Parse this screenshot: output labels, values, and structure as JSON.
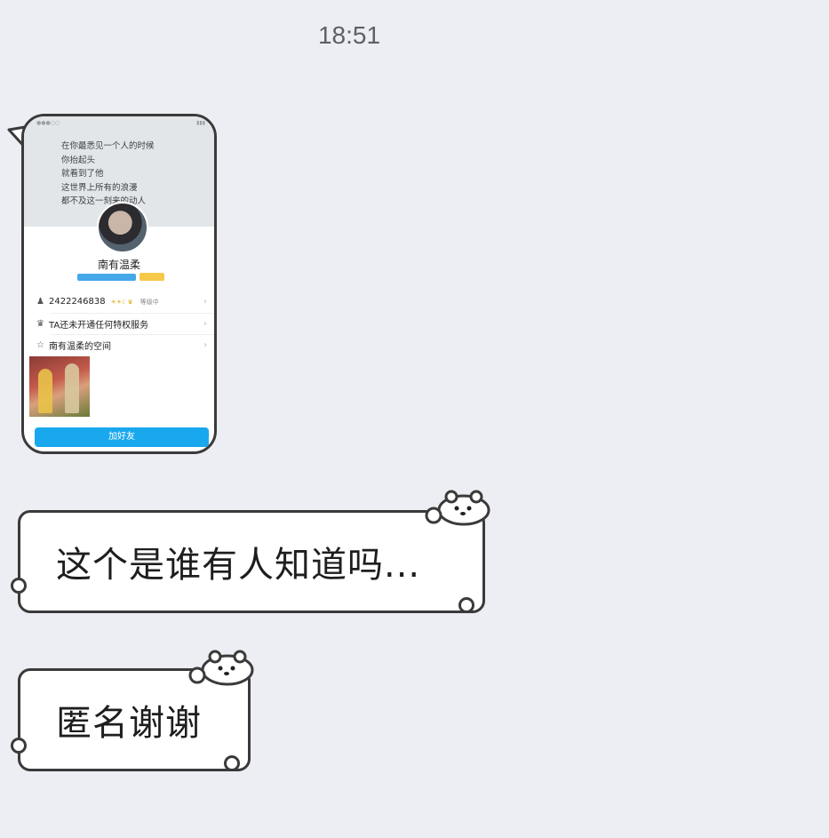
{
  "timestamp": "18:51",
  "shared_image": {
    "poem_lines": [
      "在你最悉见一个人的时候",
      "你抬起头",
      "就看到了他",
      "这世界上所有的浪漫",
      "都不及这一刻来的动人"
    ],
    "nickname": "南有温柔",
    "qq_number": "2422246838",
    "status": "等级中",
    "privilege_text": "TA还未开通任何特权服务",
    "space_text": "南有温柔的空间",
    "add_friend_label": "加好友"
  },
  "messages": [
    {
      "text": "这个是谁有人知道吗..."
    },
    {
      "text": "匿名谢谢"
    }
  ],
  "colors": {
    "background": "#eceef3",
    "add_button": "#19a8ee",
    "bubble_border": "#3a3a3a"
  }
}
